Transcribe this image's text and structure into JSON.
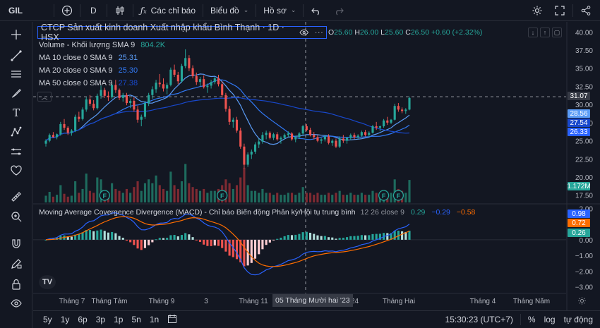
{
  "toolbar": {
    "symbol": "GIL",
    "interval": "D",
    "indicators_label": "Các chỉ báo",
    "chart_type_label": "Biểu đồ",
    "profile_label": "Hồ sơ"
  },
  "legend": {
    "title": "CTCP Sản xuất kinh doanh Xuất nhập khẩu Bình Thạnh · 1D · HSX",
    "open_label": "O",
    "open": "25.60",
    "high_label": "H",
    "high": "26.00",
    "low_label": "L",
    "low": "25.60",
    "close_label": "C",
    "close": "26.50",
    "change": "+0.60 (+2.32%)",
    "volume_label": "Volume - Khối lượng SMA 9",
    "volume_value": "804.2K",
    "ma10_label": "MA 10 close 0 SMA 9",
    "ma10_value": "25.31",
    "ma20_label": "MA 20 close 0 SMA 9",
    "ma20_value": "25.30",
    "ma50_label": "MA 50 close 0 SMA 9",
    "ma50_value": "27.38"
  },
  "macd_legend": {
    "label": "Moving Average Covergence Divergence (MACD) - Chỉ báo Biến động Phân kỳ/Hội tụ trung bình",
    "params": "12 26 close 9",
    "v1": "0.29",
    "v2": "−0.29",
    "v3": "−0.58"
  },
  "price_axis": {
    "ticks": [
      "40.00",
      "37.50",
      "35.00",
      "32.50",
      "30.00",
      "27.50",
      "25.00",
      "22.50",
      "20.00",
      "17.50"
    ],
    "crosshair_price": "31.07",
    "tag_ma50": "28.56",
    "tag_ma10": "27.54",
    "tag_close": "26.33",
    "tag_volume": "1.172M"
  },
  "macd_axis": {
    "ticks": [
      "2.00",
      "0.00",
      "−1.00",
      "−2.00",
      "−3.00"
    ],
    "tag_1": "0.98",
    "tag_2": "0.72",
    "tag_3": "0.26"
  },
  "time_axis": {
    "labels": [
      "Tháng 7",
      "Tháng Tám",
      "Tháng 9",
      "3",
      "Tháng 11",
      "2024",
      "Tháng Hai",
      "Tháng 4",
      "Tháng Năm"
    ],
    "crosshair_date": "05 Tháng Mười hai '23"
  },
  "bottombar": {
    "ranges": [
      "5y",
      "1y",
      "6p",
      "3p",
      "1p",
      "5n",
      "1n"
    ],
    "clock": "15:30:23 (UTC+7)",
    "percent_label": "%",
    "log_label": "log",
    "auto_label": "tự động"
  },
  "chart_data": {
    "type": "candlestick",
    "ylim": [
      16.5,
      41
    ],
    "candles": [
      [
        24.6,
        25.2,
        24.2,
        25.0
      ],
      [
        25.0,
        26.0,
        24.8,
        25.8
      ],
      [
        25.8,
        26.2,
        25.4,
        25.5
      ],
      [
        25.5,
        26.0,
        25.2,
        25.9
      ],
      [
        25.9,
        27.6,
        25.7,
        27.3
      ],
      [
        27.3,
        28.0,
        26.5,
        26.8
      ],
      [
        26.8,
        27.0,
        25.8,
        26.1
      ],
      [
        26.1,
        26.6,
        25.7,
        26.4
      ],
      [
        26.4,
        28.6,
        26.2,
        28.3
      ],
      [
        28.3,
        29.0,
        27.6,
        28.0
      ],
      [
        28.0,
        29.6,
        27.8,
        29.3
      ],
      [
        29.3,
        31.0,
        29.0,
        30.7
      ],
      [
        30.7,
        31.3,
        29.8,
        30.1
      ],
      [
        30.1,
        30.6,
        29.2,
        29.5
      ],
      [
        29.5,
        31.5,
        29.3,
        31.2
      ],
      [
        31.2,
        32.6,
        30.8,
        32.0
      ],
      [
        32.0,
        32.3,
        30.9,
        31.2
      ],
      [
        31.2,
        31.8,
        30.5,
        31.0
      ],
      [
        31.0,
        33.0,
        30.8,
        32.7
      ],
      [
        32.7,
        33.4,
        31.6,
        32.0
      ],
      [
        32.0,
        32.2,
        30.6,
        30.9
      ],
      [
        30.9,
        31.6,
        30.4,
        31.3
      ],
      [
        31.3,
        31.6,
        29.9,
        30.2
      ],
      [
        30.2,
        30.8,
        29.5,
        30.5
      ],
      [
        30.5,
        31.0,
        29.0,
        29.3
      ],
      [
        29.3,
        29.8,
        27.5,
        27.9
      ],
      [
        27.9,
        28.6,
        27.0,
        28.3
      ],
      [
        28.3,
        30.5,
        28.0,
        30.2
      ],
      [
        30.2,
        31.6,
        29.8,
        31.3
      ],
      [
        31.3,
        32.5,
        30.8,
        32.1
      ],
      [
        32.1,
        33.4,
        31.6,
        33.0
      ],
      [
        33.0,
        34.2,
        32.4,
        32.8
      ],
      [
        32.8,
        33.6,
        31.8,
        32.2
      ],
      [
        32.2,
        33.0,
        31.4,
        32.7
      ],
      [
        32.7,
        35.1,
        32.5,
        34.8
      ],
      [
        34.8,
        35.5,
        33.8,
        34.1
      ],
      [
        34.1,
        34.5,
        32.8,
        33.2
      ],
      [
        33.2,
        35.6,
        33.0,
        35.3
      ],
      [
        35.3,
        37.6,
        35.0,
        36.4
      ],
      [
        36.4,
        36.8,
        34.6,
        35.0
      ],
      [
        35.0,
        35.4,
        33.6,
        33.9
      ],
      [
        33.9,
        34.4,
        32.7,
        33.1
      ],
      [
        33.1,
        33.8,
        32.5,
        33.5
      ],
      [
        33.5,
        34.0,
        32.2,
        32.4
      ],
      [
        32.4,
        32.9,
        31.6,
        32.6
      ],
      [
        32.6,
        33.4,
        32.2,
        33.1
      ],
      [
        33.1,
        33.8,
        32.8,
        33.6
      ],
      [
        33.6,
        34.1,
        32.5,
        32.8
      ],
      [
        32.8,
        33.2,
        31.0,
        31.3
      ],
      [
        31.3,
        31.6,
        29.0,
        29.4
      ],
      [
        29.4,
        29.8,
        27.2,
        27.6
      ],
      [
        27.6,
        28.2,
        26.8,
        27.9
      ],
      [
        27.9,
        28.3,
        26.1,
        26.4
      ],
      [
        26.4,
        26.8,
        23.9,
        24.2
      ],
      [
        24.2,
        24.6,
        21.2,
        21.7
      ],
      [
        21.7,
        23.4,
        21.4,
        23.1
      ],
      [
        23.1,
        23.8,
        22.5,
        23.5
      ],
      [
        23.5,
        24.8,
        23.2,
        24.5
      ],
      [
        24.5,
        25.3,
        24.0,
        24.9
      ],
      [
        24.9,
        26.2,
        24.6,
        25.8
      ],
      [
        25.8,
        26.4,
        25.2,
        26.1
      ],
      [
        26.1,
        26.3,
        25.2,
        25.4
      ],
      [
        25.4,
        26.1,
        25.1,
        25.9
      ],
      [
        25.9,
        26.2,
        25.0,
        25.2
      ],
      [
        25.2,
        25.6,
        24.6,
        25.4
      ],
      [
        25.4,
        26.0,
        25.2,
        25.8
      ],
      [
        25.8,
        26.3,
        25.5,
        26.0
      ],
      [
        26.0,
        26.2,
        25.0,
        25.2
      ],
      [
        25.2,
        25.7,
        24.8,
        25.5
      ],
      [
        25.5,
        26.2,
        25.3,
        26.0
      ],
      [
        26.0,
        27.2,
        25.8,
        27.0
      ],
      [
        27.0,
        27.3,
        26.3,
        26.5
      ],
      [
        26.5,
        26.8,
        25.6,
        25.8
      ],
      [
        25.8,
        26.2,
        25.2,
        25.5
      ],
      [
        25.5,
        25.8,
        24.8,
        25.0
      ],
      [
        25.0,
        25.4,
        24.6,
        25.2
      ],
      [
        25.2,
        25.8,
        24.9,
        25.6
      ],
      [
        25.6,
        25.9,
        24.5,
        24.7
      ],
      [
        24.7,
        25.2,
        24.3,
        25.0
      ],
      [
        25.0,
        25.3,
        24.0,
        24.2
      ],
      [
        24.2,
        25.6,
        24.0,
        25.3
      ],
      [
        25.3,
        25.8,
        24.7,
        25.0
      ],
      [
        25.0,
        25.5,
        24.6,
        25.4
      ],
      [
        25.4,
        26.0,
        25.1,
        25.8
      ],
      [
        25.8,
        26.1,
        25.2,
        25.5
      ],
      [
        25.5,
        25.9,
        25.2,
        25.7
      ],
      [
        25.7,
        26.4,
        25.5,
        26.2
      ],
      [
        26.2,
        26.5,
        25.6,
        25.8
      ],
      [
        25.8,
        26.3,
        25.5,
        26.1
      ],
      [
        26.1,
        27.2,
        26.0,
        27.0
      ],
      [
        27.0,
        27.6,
        26.5,
        26.8
      ],
      [
        26.8,
        27.1,
        26.3,
        27.0
      ],
      [
        27.0,
        28.0,
        26.8,
        27.8
      ],
      [
        27.8,
        28.3,
        27.2,
        27.5
      ],
      [
        27.5,
        28.0,
        27.3,
        27.9
      ],
      [
        27.9,
        30.1,
        27.8,
        29.8
      ],
      [
        29.8,
        30.2,
        29.0,
        29.3
      ],
      [
        29.3,
        29.6,
        28.8,
        29.1
      ],
      [
        29.1,
        29.5,
        28.7,
        29.3
      ],
      [
        29.3,
        31.1,
        29.2,
        30.9
      ]
    ],
    "volumes": [
      0.35,
      0.55,
      0.3,
      0.4,
      0.9,
      0.45,
      0.3,
      0.35,
      1.1,
      0.5,
      0.7,
      1.5,
      0.6,
      0.5,
      1.3,
      1.2,
      0.6,
      0.5,
      1.0,
      0.7,
      0.6,
      0.5,
      0.7,
      0.5,
      0.8,
      1.1,
      0.6,
      1.0,
      1.2,
      1.0,
      1.4,
      0.9,
      0.7,
      0.6,
      1.6,
      0.9,
      0.7,
      1.1,
      2.0,
      1.0,
      0.8,
      0.7,
      0.6,
      0.7,
      0.5,
      0.6,
      0.6,
      0.7,
      0.9,
      1.2,
      1.0,
      0.7,
      0.9,
      1.3,
      1.8,
      0.9,
      0.6,
      0.6,
      0.5,
      0.7,
      0.5,
      0.5,
      0.4,
      0.5,
      0.4,
      0.4,
      0.5,
      0.5,
      0.4,
      0.5,
      0.8,
      0.5,
      0.5,
      0.4,
      0.5,
      0.4,
      0.4,
      0.5,
      0.4,
      0.5,
      0.6,
      0.4,
      0.4,
      0.5,
      0.4,
      0.4,
      0.5,
      0.4,
      0.4,
      0.6,
      0.5,
      0.4,
      0.6,
      0.5,
      0.5,
      1.2,
      0.7,
      0.6,
      0.5,
      1.17
    ],
    "events": [
      {
        "label": "F",
        "index": 16
      },
      {
        "label": "F",
        "index": 48
      },
      {
        "label": "F",
        "index": 92
      },
      {
        "label": "F",
        "index": 96
      }
    ]
  }
}
